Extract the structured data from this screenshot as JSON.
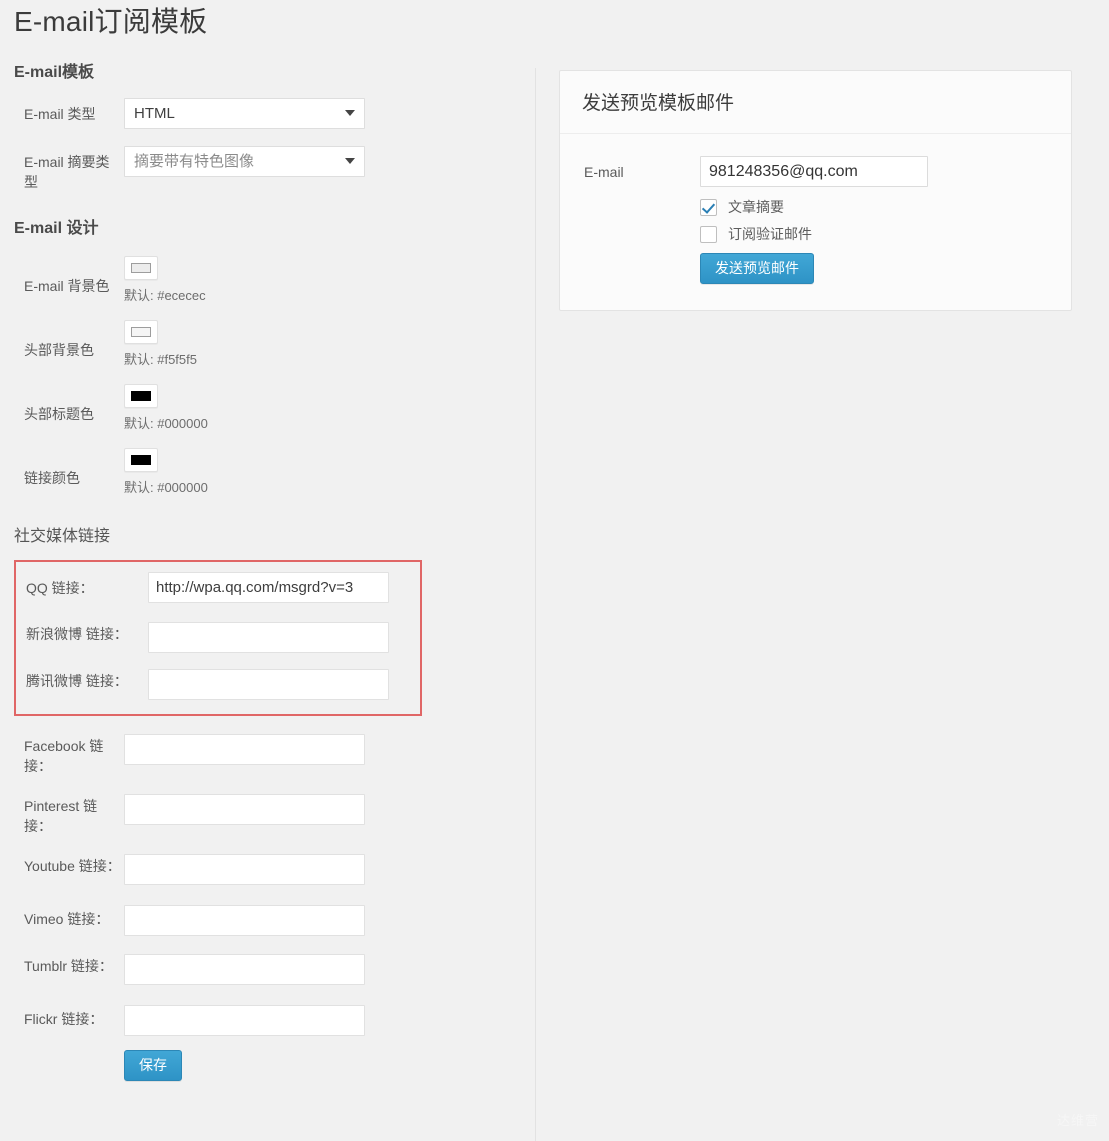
{
  "page": {
    "title": "E-mail订阅模板",
    "watermark": "达维营"
  },
  "template_section": {
    "heading": "E-mail模板",
    "rows": [
      {
        "label": "E-mail 类型",
        "control": "select",
        "value": "HTML",
        "muted": false,
        "caret": "chevron-down-icon"
      },
      {
        "label": "E-mail 摘要类型",
        "control": "select",
        "value": "摘要带有特色图像",
        "muted": true,
        "caret": "chevron-down-icon"
      }
    ]
  },
  "design_section": {
    "heading": "E-mail 设计",
    "rows": [
      {
        "label": "E-mail 背景色",
        "default_text": "默认: #ececec",
        "swatch_color": "#ececec",
        "swatch_border": "#9d9d9d"
      },
      {
        "label": "头部背景色",
        "default_text": "默认: #f5f5f5",
        "swatch_color": "#f5f5f5",
        "swatch_border": "#9d9d9d"
      },
      {
        "label": "头部标题色",
        "default_text": "默认: #000000",
        "swatch_color": "#000000",
        "swatch_border": "#000000"
      },
      {
        "label": "链接颜色",
        "default_text": "默认: #000000",
        "swatch_color": "#000000",
        "swatch_border": "#000000"
      }
    ]
  },
  "social_section": {
    "heading": "社交媒体链接",
    "highlight_color": "#e06666",
    "highlighted_rows": [
      {
        "label": "QQ 链接：",
        "value": "http://wpa.qq.com/msgrd?v=3",
        "placeholder": ""
      },
      {
        "label": "新浪微博 链接：",
        "value": "",
        "placeholder": ""
      },
      {
        "label": "腾讯微博 链接：",
        "value": "",
        "placeholder": ""
      }
    ],
    "rows": [
      {
        "label": "Facebook 链接：",
        "value": "",
        "placeholder": ""
      },
      {
        "label": "Pinterest 链接：",
        "value": "",
        "placeholder": ""
      },
      {
        "label": "Youtube 链接：",
        "value": "",
        "placeholder": ""
      },
      {
        "label": "Vimeo 链接：",
        "value": "",
        "placeholder": ""
      },
      {
        "label": "Tumblr 链接：",
        "value": "",
        "placeholder": ""
      },
      {
        "label": "Flickr 链接：",
        "value": "",
        "placeholder": ""
      }
    ],
    "save_label": "保存"
  },
  "preview_panel": {
    "title": "发送预览模板邮件",
    "email_label": "E-mail",
    "email_value": "981248356@qq.com",
    "email_placeholder": "",
    "checkboxes": [
      {
        "label": "文章摘要",
        "checked": true
      },
      {
        "label": "订阅验证邮件",
        "checked": false
      }
    ],
    "send_label": "发送预览邮件"
  }
}
